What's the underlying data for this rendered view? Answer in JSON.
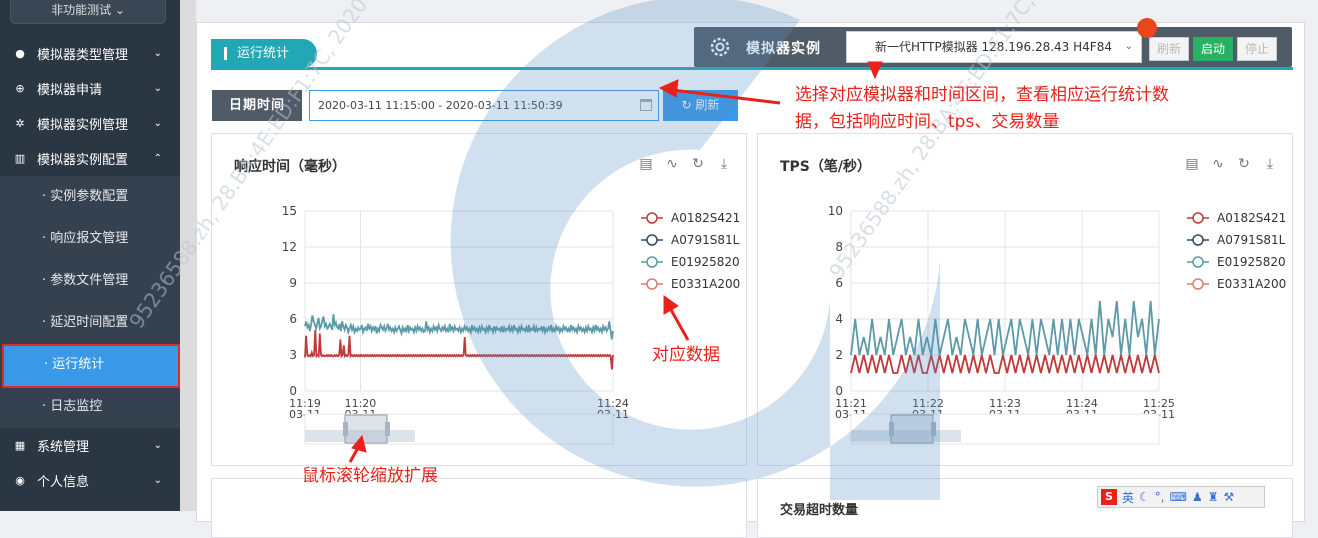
{
  "sidebar": {
    "top_button": "非功能测试 ⌄",
    "items": [
      {
        "label": "模拟器类型管理",
        "icon": "cube-icon"
      },
      {
        "label": "模拟器申请",
        "icon": "plus-circle-icon"
      },
      {
        "label": "模拟器实例管理",
        "icon": "gear-icon"
      },
      {
        "label": "模拟器实例配置",
        "icon": "bar-chart-icon"
      }
    ],
    "sub_items": [
      "实例参数配置",
      "响应报文管理",
      "参数文件管理",
      "延迟时间配置",
      "运行统计",
      "日志监控"
    ],
    "bottom_items": [
      {
        "label": "系统管理",
        "icon": "windows-icon"
      },
      {
        "label": "个人信息",
        "icon": "user-icon"
      }
    ]
  },
  "main": {
    "tab_title": "运行统计",
    "simulator": {
      "label": "模拟器实例",
      "selected": "新一代HTTP模拟器 128.196.28.43 H4F84",
      "buttons": {
        "refresh": "刷新",
        "start": "启动",
        "stop": "停止"
      }
    },
    "date": {
      "label": "日期时间",
      "value": "2020-03-11 11:15:00 - 2020-03-11 11:50:39",
      "refresh_label": "刷新"
    },
    "bottom_card_title": "交易超时数量"
  },
  "annotations": {
    "select_note_line1": "选择对应模拟器和时间区间，查看相应运行统计数",
    "select_note_line2": "据，包括响应时间、tps、交易数量",
    "data_note": "对应数据",
    "zoom_note": "鼠标滚轮缩放扩展"
  },
  "ime": {
    "label": "英"
  },
  "watermark": "95236588.zh, 28.BA:4E:ED:F1:7C, 2020-03-11",
  "colors": {
    "accent": "#3a98e8",
    "teal": "#22a7b5",
    "start": "#26b163",
    "series": [
      "#c0393b",
      "#2e4a64",
      "#5b9aa6",
      "#e07a6e"
    ]
  },
  "chart_data": [
    {
      "type": "line",
      "title": "响应时间（毫秒）",
      "ylim": [
        0,
        15
      ],
      "yticks": [
        0,
        3,
        6,
        9,
        12,
        15
      ],
      "x_ticks": [
        {
          "t": 0,
          "label": "11:19\n03-11"
        },
        {
          "t": 0.9,
          "label": "11:20\n03-11"
        },
        {
          "t": 5,
          "label": "11:24\n03-11"
        }
      ],
      "x_range": [
        0,
        5
      ],
      "series": [
        {
          "name": "A0182S421",
          "color": "#c0393b",
          "values": [
            2.8,
            4.6,
            3.0,
            2.9,
            3.0,
            2.9,
            3.2,
            2.9,
            3.0,
            5.1,
            2.9,
            3.0,
            2.9,
            4.8,
            3.0,
            2.9,
            3.0,
            2.9,
            2.9,
            3.0,
            2.9,
            3.0,
            2.9,
            3.0,
            2.9,
            2.9,
            3.0,
            2.9,
            3.0,
            2.9,
            3.0,
            4.3,
            2.9,
            3.0,
            3.8,
            2.9,
            3.0,
            2.9,
            3.0,
            4.6,
            2.9,
            3.0,
            2.9,
            3.0,
            2.9,
            3.0,
            2.9,
            3.0,
            2.9,
            3.0,
            2.9,
            3.0,
            2.9,
            3.0,
            2.9,
            3.0,
            2.9,
            3.0,
            2.9,
            3.0,
            2.9,
            3.0,
            2.9,
            3.0,
            2.9,
            3.0,
            2.9,
            3.0,
            2.9,
            3.0,
            2.9,
            3.0,
            2.9,
            3.0,
            2.9,
            3.0,
            2.9,
            3.0,
            2.9,
            3.0,
            2.9,
            3.0,
            2.9,
            3.0,
            2.9,
            3.0,
            2.9,
            3.0,
            2.9,
            3.0,
            2.9,
            3.0,
            2.9,
            3.0,
            2.9,
            3.0,
            2.9,
            3.0,
            2.9,
            3.0,
            2.9,
            3.0,
            2.9,
            3.0,
            2.9,
            3.0,
            2.9,
            3.0,
            2.9,
            3.0,
            2.9,
            3.0,
            2.9,
            3.0,
            2.9,
            3.0,
            2.9,
            3.0,
            2.9,
            3.0,
            2.9,
            3.0,
            2.9,
            3.0,
            2.9,
            3.0,
            2.9,
            3.0,
            2.9,
            3.0,
            2.9,
            3.0,
            2.9,
            3.0,
            2.9,
            3.0,
            2.9,
            3.0,
            2.9,
            3.0,
            4.5,
            3.0,
            2.9,
            3.0,
            2.9,
            3.0,
            2.9,
            3.0,
            2.9,
            3.0,
            2.9,
            3.0,
            2.9,
            3.0,
            2.9,
            3.0,
            2.9,
            3.0,
            2.9,
            3.0,
            2.9,
            3.0,
            2.9,
            3.0,
            2.9,
            3.0,
            2.9,
            3.0,
            2.9,
            3.0,
            2.9,
            3.0,
            2.9,
            3.0,
            2.9,
            3.0,
            2.9,
            3.0,
            2.9,
            3.0,
            2.9,
            3.0,
            2.9,
            3.0,
            2.9,
            3.0,
            2.9,
            3.0,
            2.9,
            3.0,
            2.9,
            3.0,
            2.9,
            3.0,
            2.9,
            3.0,
            2.9,
            3.0,
            2.9,
            3.0,
            2.9,
            3.0,
            2.9,
            3.0,
            2.9,
            3.0,
            2.9,
            3.0,
            2.9,
            3.0,
            2.9,
            3.0,
            2.9,
            3.0,
            2.9,
            3.0,
            2.9,
            3.0,
            2.9,
            3.0,
            2.9,
            3.0,
            2.9,
            3.0,
            2.9,
            3.0,
            2.9,
            3.0,
            2.9,
            3.0,
            2.9,
            3.0,
            2.9,
            3.0,
            2.9,
            3.0,
            2.9,
            3.0,
            2.9,
            3.0,
            2.9,
            3.0,
            2.9,
            3.0,
            2.9,
            3.0,
            2.9,
            3.0,
            2.9,
            3.0,
            2.9,
            3.0,
            2.9,
            3.0,
            2.9,
            3.0,
            2.9,
            3.0,
            2.9,
            3.0,
            2.9,
            3.0,
            2.9,
            3.0,
            2.9,
            3.0,
            2.9,
            3.0,
            2.9,
            1.8,
            3.0
          ]
        },
        {
          "name": "A0791S81L",
          "color": "#2e4a64",
          "values": []
        },
        {
          "name": "E01925820",
          "color": "#5b9aa6",
          "values": [
            5.4,
            5.8,
            5.3,
            5.5,
            5.0,
            5.6,
            6.3,
            5.8,
            5.5,
            5.2,
            5.7,
            6.1,
            5.2,
            5.4,
            5.9,
            6.2,
            5.4,
            5.6,
            5.2,
            5.3,
            5.6,
            5.4,
            5.1,
            6.4,
            5.5,
            5.7,
            5.3,
            5.2,
            5.6,
            5.0,
            5.8,
            5.4,
            5.1,
            5.5,
            5.3,
            4.9,
            5.2,
            5.5,
            5.1,
            5.4,
            4.9,
            5.2,
            5.0,
            5.3,
            5.1,
            5.2,
            5.5,
            4.9,
            5.2,
            5.3,
            5.0,
            5.6,
            5.2,
            5.4,
            5.0,
            5.3,
            5.1,
            5.4,
            4.8,
            5.2,
            5.0,
            5.5,
            5.3,
            5.1,
            5.4,
            5.0,
            5.2,
            5.6,
            5.1,
            5.3,
            5.0,
            5.2,
            4.9,
            5.3,
            5.0,
            5.2,
            5.4,
            5.1,
            4.8,
            5.3,
            5.0,
            5.2,
            4.9,
            5.5,
            5.0,
            5.3,
            5.1,
            5.2,
            4.9,
            5.3,
            5.0,
            5.4,
            5.1,
            5.3,
            5.0,
            5.2,
            4.9,
            5.0,
            5.8,
            5.1,
            5.3,
            4.9,
            5.2,
            5.0,
            5.4,
            5.1,
            5.3,
            5.0,
            5.5,
            5.2,
            5.0,
            5.3,
            5.1,
            5.4,
            5.0,
            5.2,
            4.9,
            5.6,
            5.1,
            5.3,
            5.0,
            5.4,
            5.1,
            5.2,
            5.0,
            5.3,
            4.9,
            5.2,
            5.0,
            5.4,
            5.1,
            5.3,
            5.0,
            5.2,
            4.9,
            5.5,
            5.1,
            5.3,
            5.0,
            5.2,
            4.9,
            5.3,
            5.0,
            5.4,
            5.1,
            5.2,
            4.9,
            5.3,
            5.0,
            5.5,
            5.1,
            5.2,
            4.9,
            5.4,
            5.0,
            5.3,
            5.1,
            5.2,
            5.0,
            5.4,
            4.9,
            5.3,
            5.0,
            5.2,
            5.1,
            5.4,
            4.9,
            5.3,
            5.0,
            5.5,
            5.1,
            5.2,
            4.9,
            5.3,
            5.0,
            5.4,
            5.1,
            5.2,
            5.0,
            5.3,
            4.9,
            5.5,
            5.0,
            5.2,
            5.1,
            5.4,
            4.9,
            5.3,
            5.0,
            5.2,
            5.1,
            5.3,
            5.0,
            5.4,
            4.9,
            5.2,
            5.0,
            5.3,
            5.1,
            5.5,
            4.9,
            5.2,
            5.0,
            5.4,
            5.1,
            5.3,
            4.9,
            5.2,
            5.0,
            5.4,
            5.1,
            5.3,
            5.0,
            5.2,
            4.9,
            5.5,
            5.1,
            5.3,
            5.0,
            5.2,
            4.9,
            5.4,
            5.1,
            5.3,
            5.0,
            5.2,
            4.9,
            5.3,
            5.0,
            5.4,
            5.1,
            5.2,
            4.9,
            5.3,
            5.0,
            5.5,
            5.1,
            5.3,
            5.0,
            5.2,
            4.9,
            5.4,
            5.1,
            5.3,
            5.0,
            5.2,
            5.8,
            5.1,
            4.3,
            5.0
          ]
        },
        {
          "name": "E0331A200",
          "color": "#e07a6e",
          "values": []
        }
      ]
    },
    {
      "type": "line",
      "title": "TPS（笔/秒）",
      "ylim": [
        0,
        10
      ],
      "yticks": [
        0,
        2,
        4,
        6,
        8,
        10
      ],
      "x_ticks": [
        {
          "t": 0,
          "label": "11:21\n03-11"
        },
        {
          "t": 1,
          "label": "11:22\n03-11"
        },
        {
          "t": 2,
          "label": "11:23\n03-11"
        },
        {
          "t": 3,
          "label": "11:24\n03-11"
        },
        {
          "t": 4,
          "label": "11:25\n03-11"
        }
      ],
      "x_range": [
        0,
        4
      ],
      "series": [
        {
          "name": "A0182S421",
          "color": "#c0393b",
          "values": [
            1,
            2,
            1,
            2,
            1,
            2,
            1,
            2,
            1,
            2,
            1,
            1,
            2,
            1,
            2,
            1,
            2,
            1,
            1,
            2,
            1,
            2,
            1,
            2,
            1,
            2,
            1,
            2,
            1,
            2,
            1,
            2,
            1,
            2,
            1,
            1,
            2,
            1,
            2,
            1,
            2,
            1,
            2,
            1,
            2,
            1,
            2,
            1,
            2,
            1,
            2,
            1,
            2,
            1,
            2,
            1,
            2,
            1,
            2,
            1,
            2,
            1,
            2,
            1,
            2,
            1,
            2,
            1,
            2,
            1,
            2,
            1,
            2,
            1
          ]
        },
        {
          "name": "A0791S81L",
          "color": "#2e4a64",
          "values": []
        },
        {
          "name": "E01925820",
          "color": "#5b9aa6",
          "values": [
            2,
            4,
            2,
            3,
            2,
            4,
            2,
            3,
            2,
            4,
            2,
            3,
            4,
            2,
            3,
            2,
            4,
            2,
            3,
            2,
            4,
            2,
            3,
            4,
            2,
            3,
            2,
            4,
            3,
            2,
            4,
            2,
            3,
            4,
            2,
            4,
            2,
            3,
            4,
            2,
            4,
            3,
            2,
            4,
            2,
            4,
            3,
            2,
            4,
            2,
            4,
            2,
            4,
            2,
            4,
            3,
            2,
            4,
            2,
            5,
            2,
            4,
            3,
            5,
            2,
            4,
            2,
            5,
            3,
            4,
            2,
            5,
            2,
            4
          ]
        },
        {
          "name": "E0331A200",
          "color": "#e07a6e",
          "values": []
        }
      ]
    }
  ]
}
